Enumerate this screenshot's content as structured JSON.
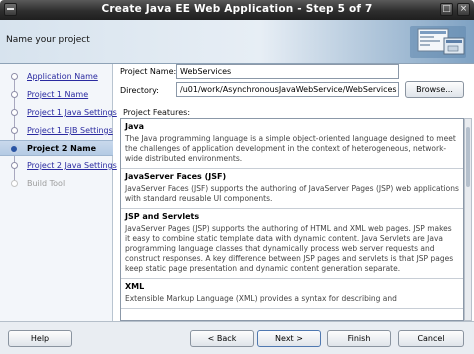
{
  "window": {
    "title": "Create Java EE Web Application - Step 5 of 7",
    "close_glyph": "×",
    "max_glyph": "□"
  },
  "header": {
    "title": "Name your project"
  },
  "steps": [
    {
      "label": "Application Name",
      "state": "done"
    },
    {
      "label": "Project 1 Name",
      "state": "done"
    },
    {
      "label": "Project 1 Java Settings",
      "state": "done"
    },
    {
      "label": "Project 1 EJB Settings",
      "state": "done"
    },
    {
      "label": "Project 2 Name",
      "state": "current"
    },
    {
      "label": "Project 2 Java Settings",
      "state": "done"
    },
    {
      "label": "Build Tool",
      "state": "disabled"
    }
  ],
  "form": {
    "project_name_label": "Project Name:",
    "project_name_value": "WebServices",
    "directory_label": "Directory:",
    "directory_value": "/u01/work/AsynchronousJavaWebService/WebServices",
    "browse_label": "Browse...",
    "features_label": "Project Features:"
  },
  "features": [
    {
      "name": "Java",
      "desc": "The Java programming language is a simple object-oriented language designed to meet the challenges of application development in the context of heterogeneous, network-wide distributed environments."
    },
    {
      "name": "JavaServer Faces (JSF)",
      "desc": "JavaServer Faces (JSF) supports the authoring of JavaServer Pages (JSP) web applications with standard reusable UI components."
    },
    {
      "name": "JSP and Servlets",
      "desc": "JavaServer Pages (JSP) supports the authoring of HTML and XML web pages. JSP makes it easy to combine static template data with dynamic content. Java Servlets are Java programming language classes that dynamically process web server requests and construct responses. A key difference between JSP pages and servlets is that JSP pages keep static page presentation and dynamic content generation separate."
    },
    {
      "name": "XML",
      "desc": "Extensible Markup Language (XML) provides a syntax for describing and"
    }
  ],
  "footer": {
    "help": "Help",
    "back": "< Back",
    "next": "Next >",
    "finish": "Finish",
    "cancel": "Cancel"
  }
}
